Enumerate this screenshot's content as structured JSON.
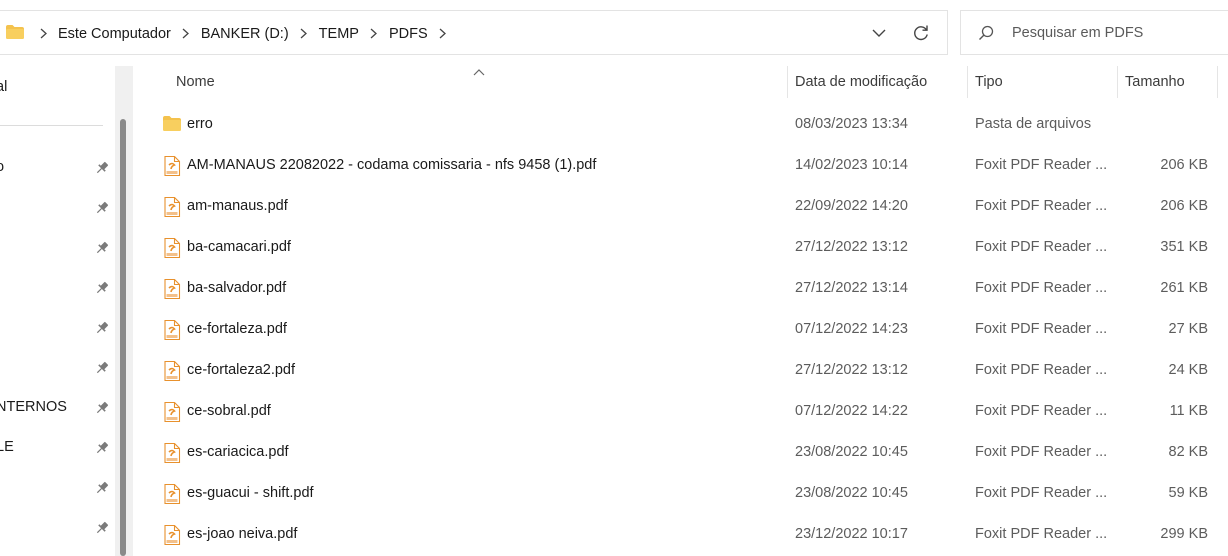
{
  "address": {
    "crumbs": [
      "Este Computador",
      "BANKER (D:)",
      "TEMP",
      "PDFS"
    ],
    "folder_icon": "folder-icon",
    "dropdown_icon": "chevron-down-icon",
    "refresh_icon": "refresh-icon"
  },
  "search": {
    "placeholder": "Pesquisar em PDFS",
    "icon": "search-icon"
  },
  "nav": {
    "items": [
      {
        "label": "al",
        "pinned": false
      },
      {
        "label": "o",
        "pinned": true
      },
      {
        "label": "",
        "pinned": true
      },
      {
        "label": "",
        "pinned": true
      },
      {
        "label": "",
        "pinned": true
      },
      {
        "label": "",
        "pinned": true
      },
      {
        "label": "",
        "pinned": true
      },
      {
        "label": "NTERNOS",
        "pinned": true
      },
      {
        "label": "LE",
        "pinned": true
      },
      {
        "label": "",
        "pinned": true
      },
      {
        "label": "",
        "pinned": true
      }
    ]
  },
  "columns": {
    "name": "Nome",
    "date": "Data de modificação",
    "type": "Tipo",
    "size": "Tamanho"
  },
  "files": [
    {
      "name": "erro",
      "date": "08/03/2023 13:34",
      "type": "Pasta de arquivos",
      "size": "",
      "kind": "folder"
    },
    {
      "name": "AM-MANAUS 22082022 - codama comissaria - nfs 9458 (1).pdf",
      "date": "14/02/2023 10:14",
      "type": "Foxit PDF Reader ...",
      "size": "206 KB",
      "kind": "pdf"
    },
    {
      "name": "am-manaus.pdf",
      "date": "22/09/2022 14:20",
      "type": "Foxit PDF Reader ...",
      "size": "206 KB",
      "kind": "pdf"
    },
    {
      "name": "ba-camacari.pdf",
      "date": "27/12/2022 13:12",
      "type": "Foxit PDF Reader ...",
      "size": "351 KB",
      "kind": "pdf"
    },
    {
      "name": "ba-salvador.pdf",
      "date": "27/12/2022 13:14",
      "type": "Foxit PDF Reader ...",
      "size": "261 KB",
      "kind": "pdf"
    },
    {
      "name": "ce-fortaleza.pdf",
      "date": "07/12/2022 14:23",
      "type": "Foxit PDF Reader ...",
      "size": "27 KB",
      "kind": "pdf"
    },
    {
      "name": "ce-fortaleza2.pdf",
      "date": "27/12/2022 13:12",
      "type": "Foxit PDF Reader ...",
      "size": "24 KB",
      "kind": "pdf"
    },
    {
      "name": "ce-sobral.pdf",
      "date": "07/12/2022 14:22",
      "type": "Foxit PDF Reader ...",
      "size": "11 KB",
      "kind": "pdf"
    },
    {
      "name": "es-cariacica.pdf",
      "date": "23/08/2022 10:45",
      "type": "Foxit PDF Reader ...",
      "size": "82 KB",
      "kind": "pdf"
    },
    {
      "name": "es-guacui - shift.pdf",
      "date": "23/08/2022 10:45",
      "type": "Foxit PDF Reader ...",
      "size": "59 KB",
      "kind": "pdf"
    },
    {
      "name": "es-joao neiva.pdf",
      "date": "23/12/2022 10:17",
      "type": "Foxit PDF Reader ...",
      "size": "299 KB",
      "kind": "pdf"
    }
  ],
  "colors": {
    "folder": "#f4c24d",
    "pdf_accent": "#e8912d",
    "text_secondary": "#5c5c5c"
  }
}
